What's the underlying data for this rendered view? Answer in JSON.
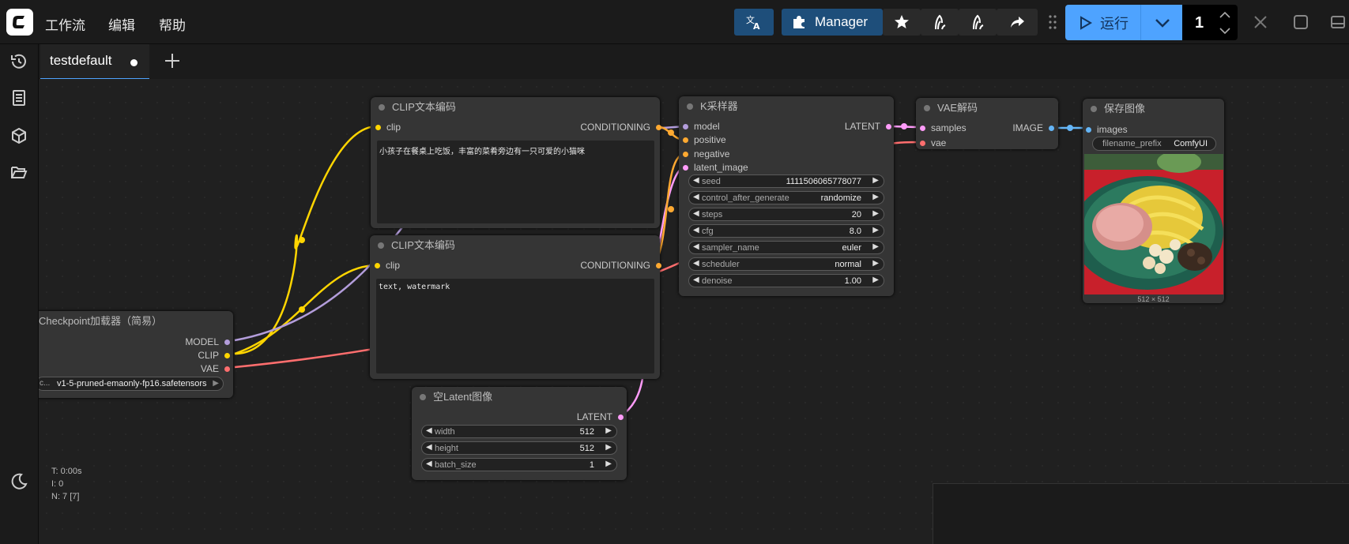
{
  "menu": [
    "工作流",
    "编辑",
    "帮助"
  ],
  "toolbar": {
    "manager_label": "Manager",
    "run_label": "运行",
    "queue_count": "1"
  },
  "tabs": [
    {
      "label": "testdefault"
    }
  ],
  "nodes": {
    "clip_pos": {
      "title": "CLIP文本编码",
      "input": "clip",
      "output": "CONDITIONING",
      "text": "小孩子在餐桌上吃饭，丰富的菜肴旁边有一只可爱的小猫咪"
    },
    "clip_neg": {
      "title": "CLIP文本编码",
      "input": "clip",
      "output": "CONDITIONING",
      "text": "text, watermark"
    },
    "ksampler": {
      "title": "K采样器",
      "inputs": [
        "model",
        "positive",
        "negative",
        "latent_image"
      ],
      "output": "LATENT",
      "widgets": [
        {
          "name": "seed",
          "value": "1111506065778077"
        },
        {
          "name": "control_after_generate",
          "value": "randomize"
        },
        {
          "name": "steps",
          "value": "20"
        },
        {
          "name": "cfg",
          "value": "8.0"
        },
        {
          "name": "sampler_name",
          "value": "euler"
        },
        {
          "name": "scheduler",
          "value": "normal"
        },
        {
          "name": "denoise",
          "value": "1.00"
        }
      ]
    },
    "vae_decode": {
      "title": "VAE解码",
      "inputs": [
        "samples",
        "vae"
      ],
      "output": "IMAGE"
    },
    "save_image": {
      "title": "保存图像",
      "input": "images",
      "prefix_label": "filename_prefix",
      "prefix_value": "ComfyUI",
      "image_size": "512 × 512"
    },
    "checkpoint": {
      "title": "Checkpoint加载器（简易）",
      "outputs": [
        "MODEL",
        "CLIP",
        "VAE"
      ],
      "ckpt_label": "c...",
      "ckpt_value": "v1-5-pruned-emaonly-fp16.safetensors"
    },
    "empty_latent": {
      "title": "空Latent图像",
      "output": "LATENT",
      "widgets": [
        {
          "name": "width",
          "value": "512"
        },
        {
          "name": "height",
          "value": "512"
        },
        {
          "name": "batch_size",
          "value": "1"
        }
      ]
    }
  },
  "stats": {
    "time": "T: 0:00s",
    "i": "I: 0",
    "n": "N: 7 [7]"
  },
  "colors": {
    "accent": "#4ea3ff",
    "clip_link": "#ffd500",
    "model_link": "#b39ddb",
    "vae_link": "#ff6e6e",
    "latent_link": "#ff9cf9",
    "image_link": "#64b5f6",
    "conditioning_link": "#ffa931"
  }
}
